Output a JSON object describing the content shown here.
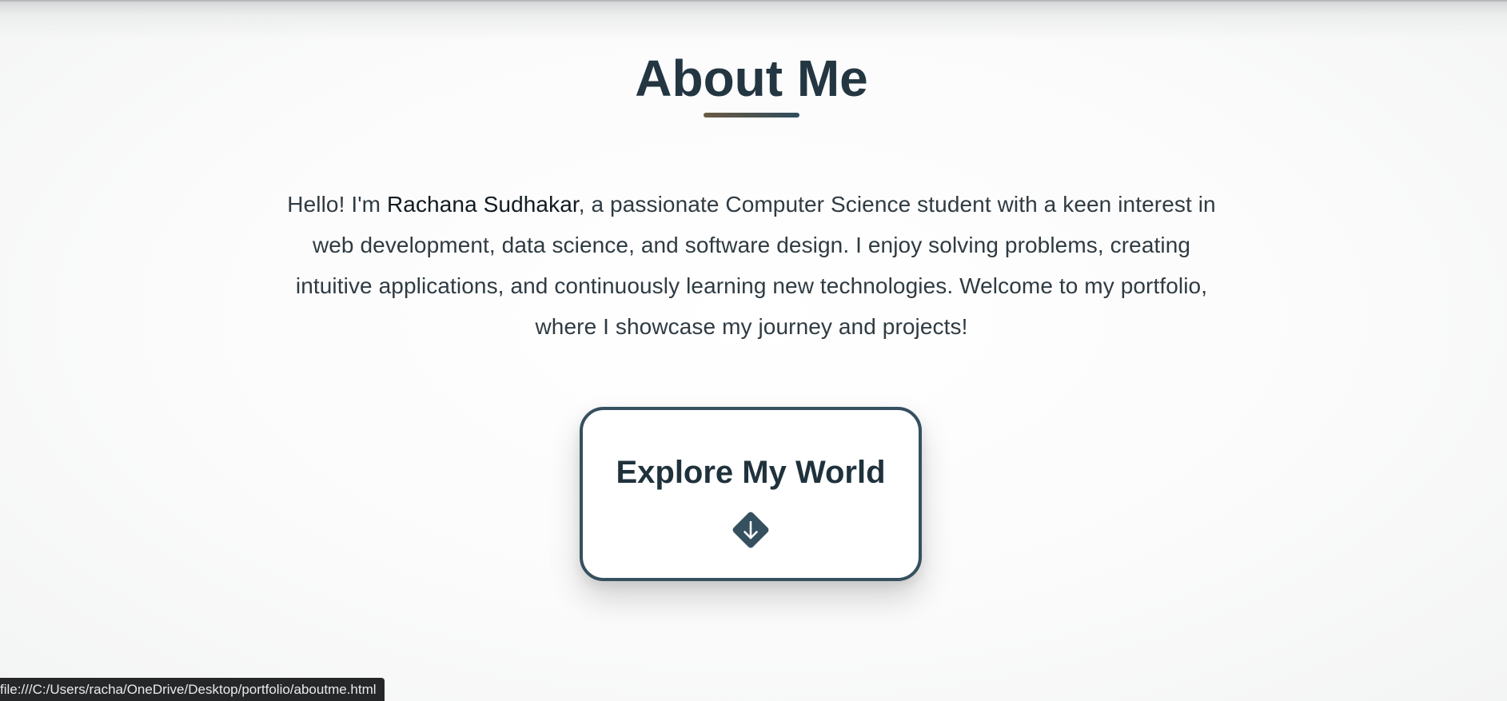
{
  "header": {
    "title": "About Me"
  },
  "intro": {
    "prefix": "Hello! I'm ",
    "name": "Rachana Sudhakar",
    "suffix": ", a passionate Computer Science student with a keen interest in web development, data science, and software design. I enjoy solving problems, creating intuitive applications, and continuously learning new technologies. Welcome to my portfolio, where I showcase my journey and projects!"
  },
  "cta": {
    "label": "Explore My World",
    "icon": "arrow-down-diamond-icon"
  },
  "status_bar": {
    "url": "file:///C:/Users/racha/OneDrive/Desktop/portfolio/aboutme.html"
  },
  "colors": {
    "title": "#233641",
    "accent": "#35505f",
    "underline_start": "#6a5a43",
    "underline_end": "#2f4d5e"
  }
}
